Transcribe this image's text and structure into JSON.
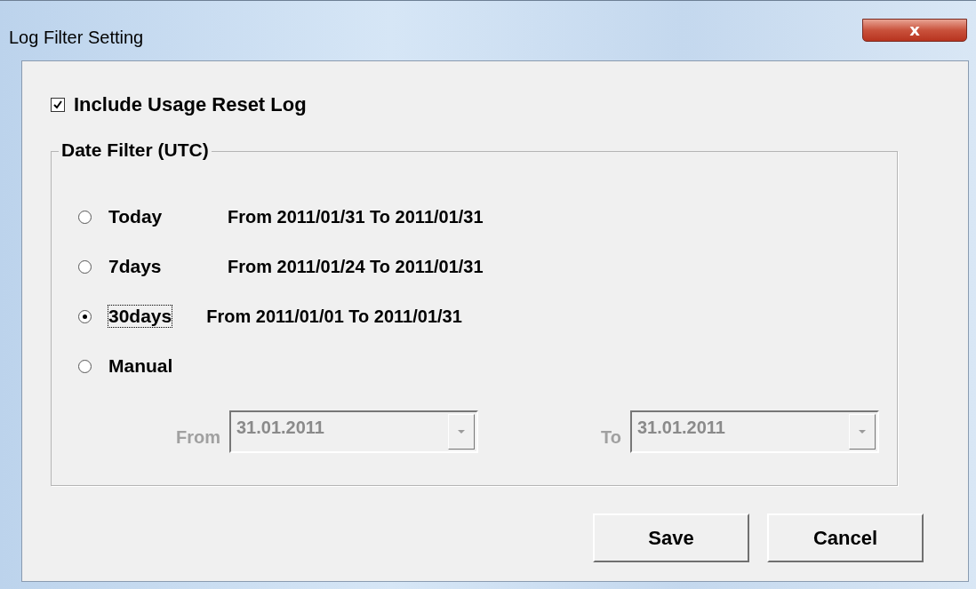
{
  "window": {
    "title": "Log Filter Setting",
    "close_label": "x"
  },
  "include_reset_log": {
    "label": "Include Usage Reset Log",
    "checked": true
  },
  "date_filter": {
    "title": "Date Filter (UTC)",
    "options": [
      {
        "label": "Today",
        "range": "From 2011/01/31 To 2011/01/31",
        "selected": false,
        "focused": false
      },
      {
        "label": "7days",
        "range": "From 2011/01/24 To 2011/01/31",
        "selected": false,
        "focused": false
      },
      {
        "label": "30days",
        "range": "From 2011/01/01 To 2011/01/31",
        "selected": true,
        "focused": true
      },
      {
        "label": "Manual",
        "selected": false,
        "focused": false
      }
    ],
    "from": {
      "label": "From",
      "value": "31.01.2011",
      "disabled": true
    },
    "to": {
      "label": "To",
      "value": "31.01.2011",
      "disabled": true
    }
  },
  "buttons": [
    "Save",
    "Cancel"
  ]
}
